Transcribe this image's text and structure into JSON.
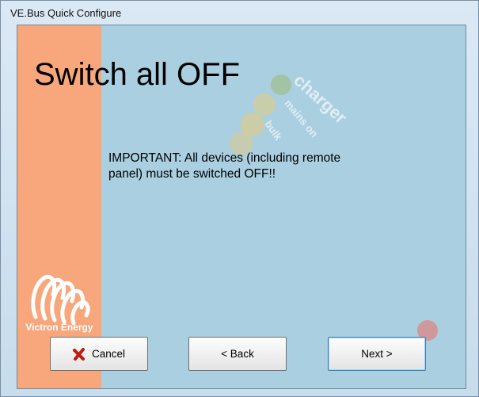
{
  "window": {
    "title": "VE.Bus Quick Configure"
  },
  "page": {
    "heading": "Switch all OFF",
    "message": "IMPORTANT: All devices (including remote panel) must be switched OFF!!"
  },
  "branding": {
    "logo_text": "Victron Energy"
  },
  "background_watermark": {
    "charger": "charger",
    "mains_on": "mains on",
    "bulk": "bulk"
  },
  "buttons": {
    "cancel": "Cancel",
    "back": "< Back",
    "next": "Next >"
  },
  "colors": {
    "band": "#f8a77c",
    "panel": "#a9cfe1",
    "cancel_icon": "#c0180b"
  }
}
